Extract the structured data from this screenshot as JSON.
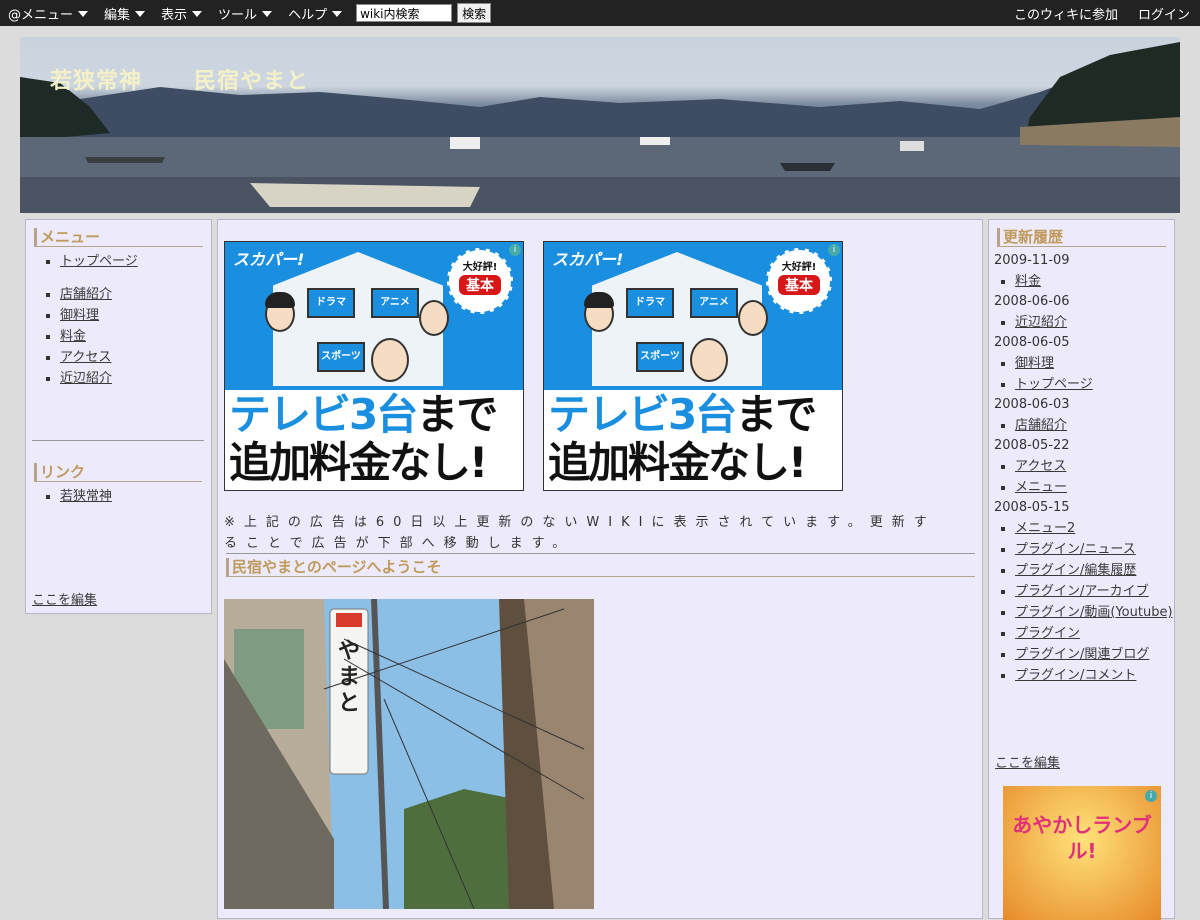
{
  "topbar": {
    "menus": [
      "@メニュー",
      "編集",
      "表示",
      "ツール",
      "ヘルプ"
    ],
    "search_value": "wiki内検索",
    "search_button": "検索",
    "join": "このウィキに参加",
    "login": "ログイン"
  },
  "banner": {
    "title_1": "若狭常神",
    "title_2": "民宿やまと"
  },
  "left": {
    "menu_title": "メニュー",
    "top_link": "トップページ",
    "menu_items": [
      "店舗紹介",
      "御料理",
      "料金",
      "アクセス",
      "近辺紹介"
    ],
    "link_title": "リンク",
    "link_items": [
      "若狭常神"
    ],
    "edit": "ここを編集"
  },
  "ads": [
    {
      "brand": "スカパー!",
      "tv_labels": [
        "ドラマ",
        "アニメ",
        "スポーツ"
      ],
      "seal_top": "大好評!",
      "seal_main": "基本",
      "line1_blue": "テレビ3台",
      "line1_black": "まで",
      "line2": "追加料金なし!"
    },
    {
      "brand": "スカパー!",
      "tv_labels": [
        "ドラマ",
        "アニメ",
        "スポーツ"
      ],
      "seal_top": "大好評!",
      "seal_main": "基本",
      "line1_blue": "テレビ3台",
      "line1_black": "まで",
      "line2": "追加料金なし!"
    }
  ],
  "main": {
    "notice": "※上記の広告は60日以上更新のないWIKIに表示されています。更新することで広告が下部へ移動します。",
    "welcome_title": "民宿やまとのページへようこそ",
    "sign_text": "やまと"
  },
  "right": {
    "title": "更新履歴",
    "history": [
      {
        "date": "2009-11-09",
        "items": [
          "料金"
        ]
      },
      {
        "date": "2008-06-06",
        "items": [
          "近辺紹介"
        ]
      },
      {
        "date": "2008-06-05",
        "items": [
          "御料理",
          "トップページ"
        ]
      },
      {
        "date": "2008-06-03",
        "items": [
          "店舗紹介"
        ]
      },
      {
        "date": "2008-05-22",
        "items": [
          "アクセス",
          "メニュー"
        ]
      },
      {
        "date": "2008-05-15",
        "items": [
          "メニュー2",
          "プラグイン/ニュース",
          "プラグイン/編集履歴",
          "プラグイン/アーカイブ",
          "プラグイン/動画(Youtube)",
          "プラグイン",
          "プラグイン/関連ブログ",
          "プラグイン/コメント"
        ]
      }
    ],
    "edit": "ここを編集",
    "ad_text": "あやかしランブル!"
  },
  "colors": {
    "topbar": "#222222",
    "column_bg": "#edebfb",
    "heading": "#c09a5c",
    "ad_blue": "#1a8fe0",
    "banner_title": "#f4f0c8"
  }
}
